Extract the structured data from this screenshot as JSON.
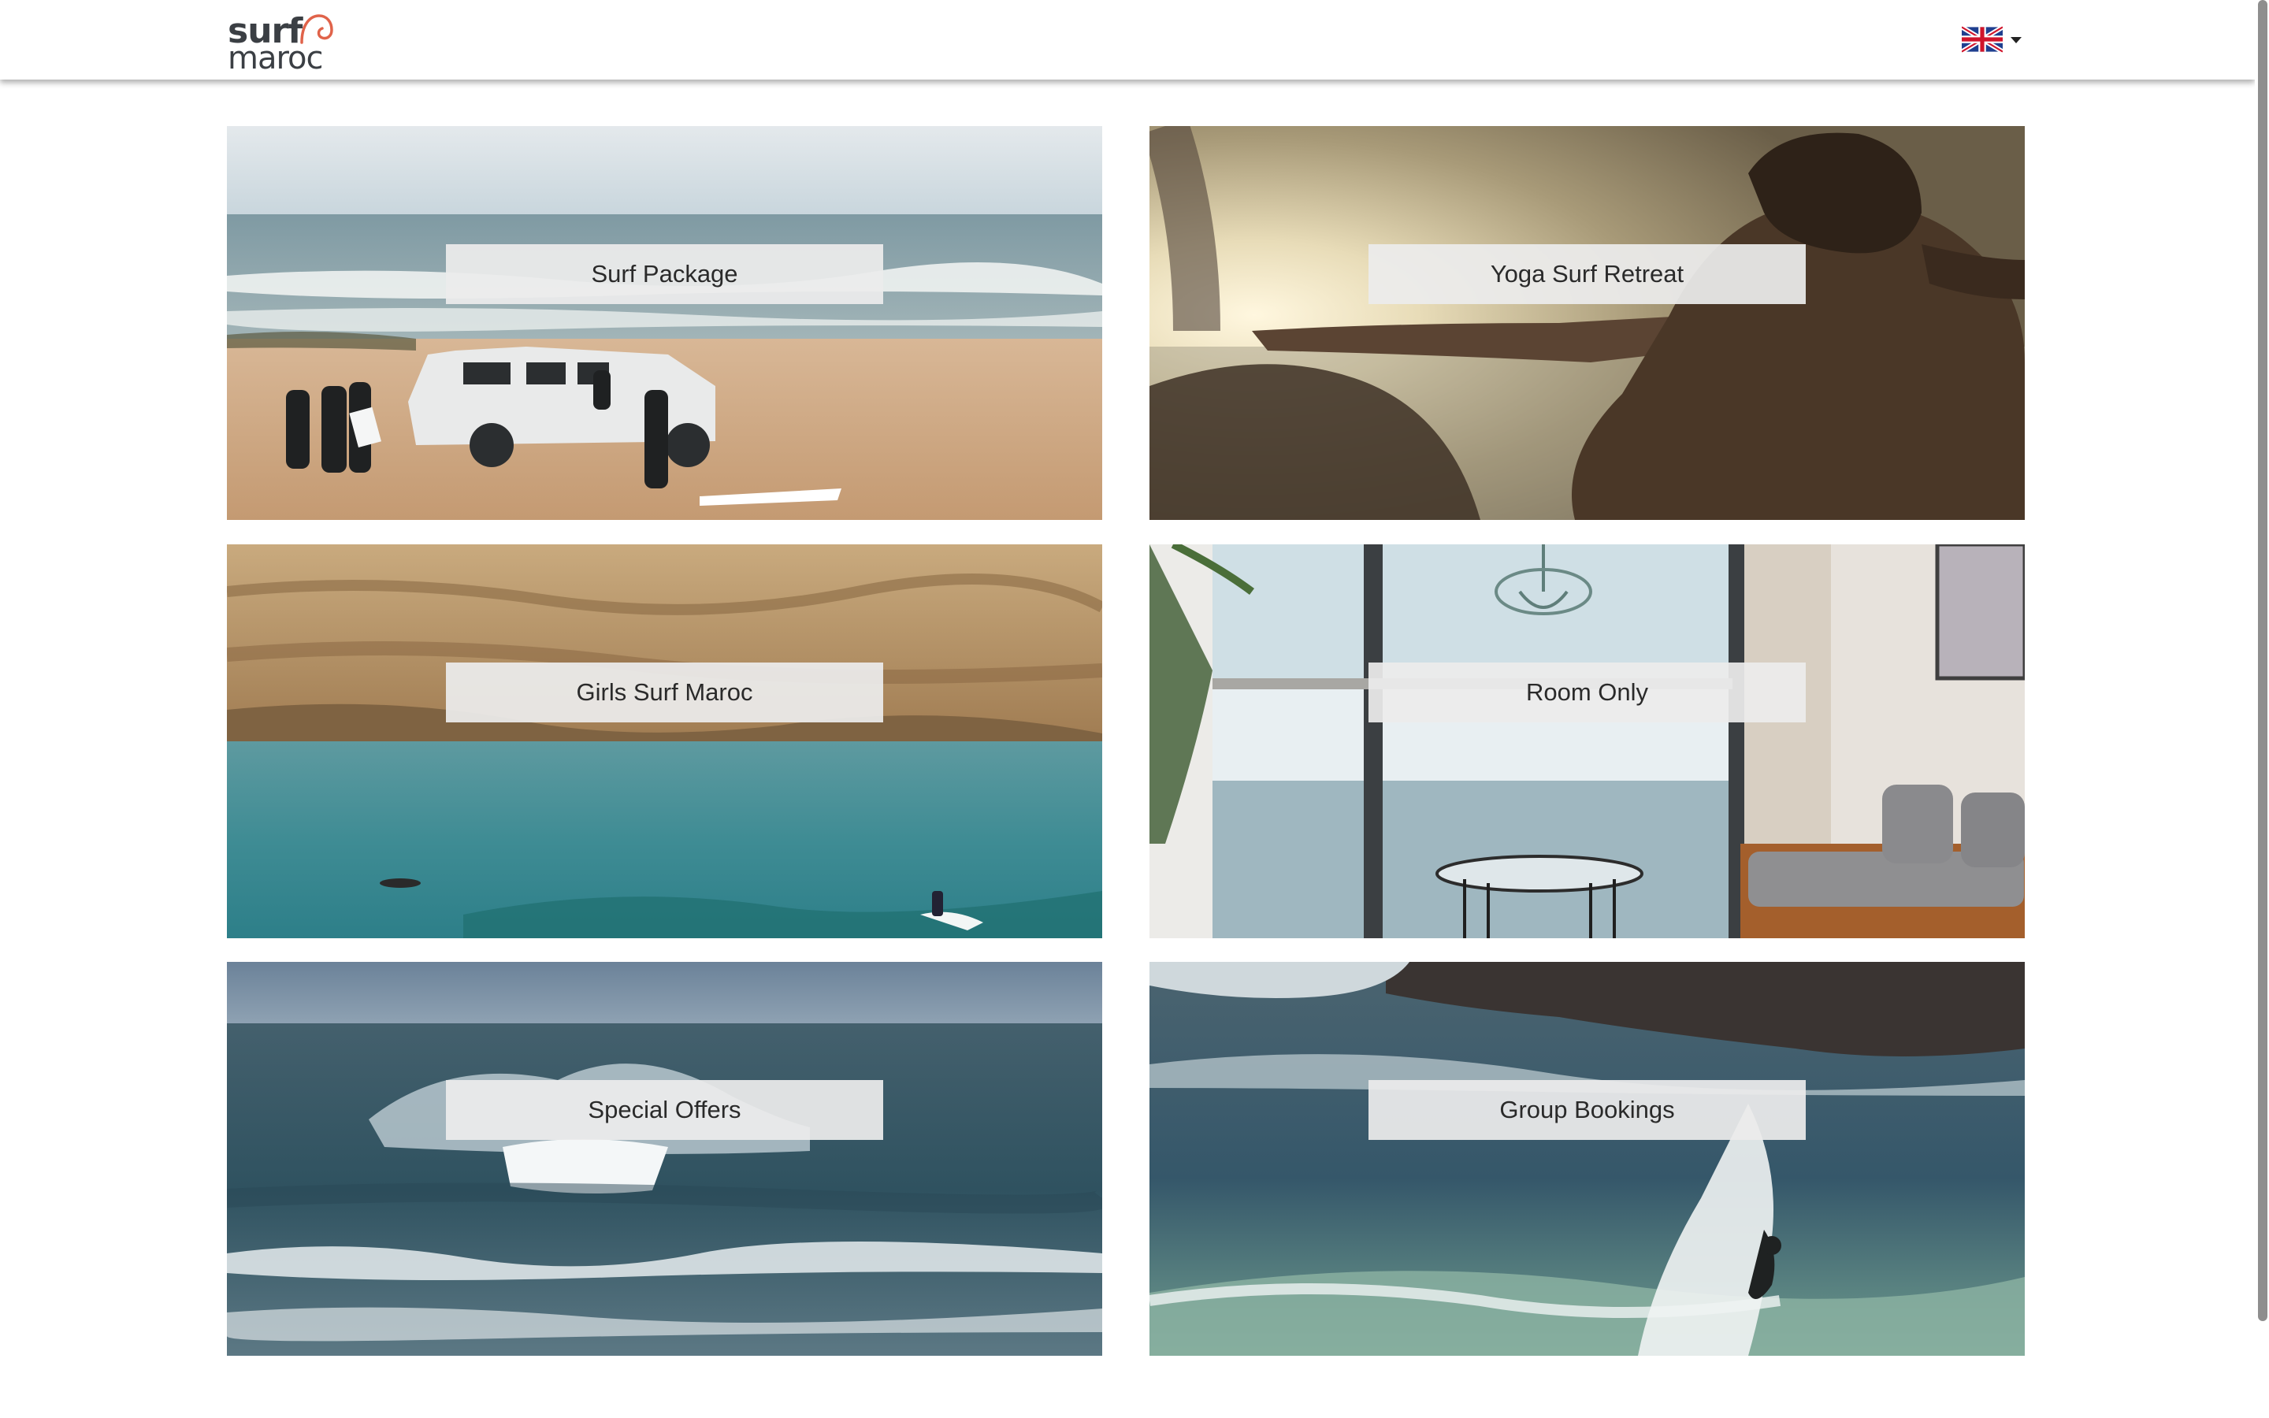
{
  "header": {
    "logo_text_top": "surf",
    "logo_text_bottom": "maroc",
    "language_flag_icon": "uk-flag-icon",
    "language_dropdown_icon": "caret-down-icon"
  },
  "cards": [
    {
      "label": "Surf Package"
    },
    {
      "label": "Yoga Surf Retreat"
    },
    {
      "label": "Girls Surf Maroc"
    },
    {
      "label": "Room Only"
    },
    {
      "label": "Special Offers"
    },
    {
      "label": "Group Bookings"
    }
  ],
  "colors": {
    "logo_accent": "#e0634a",
    "logo_text": "#3b3f44",
    "label_bg": "#ececec",
    "label_text": "#2a2a2a"
  }
}
